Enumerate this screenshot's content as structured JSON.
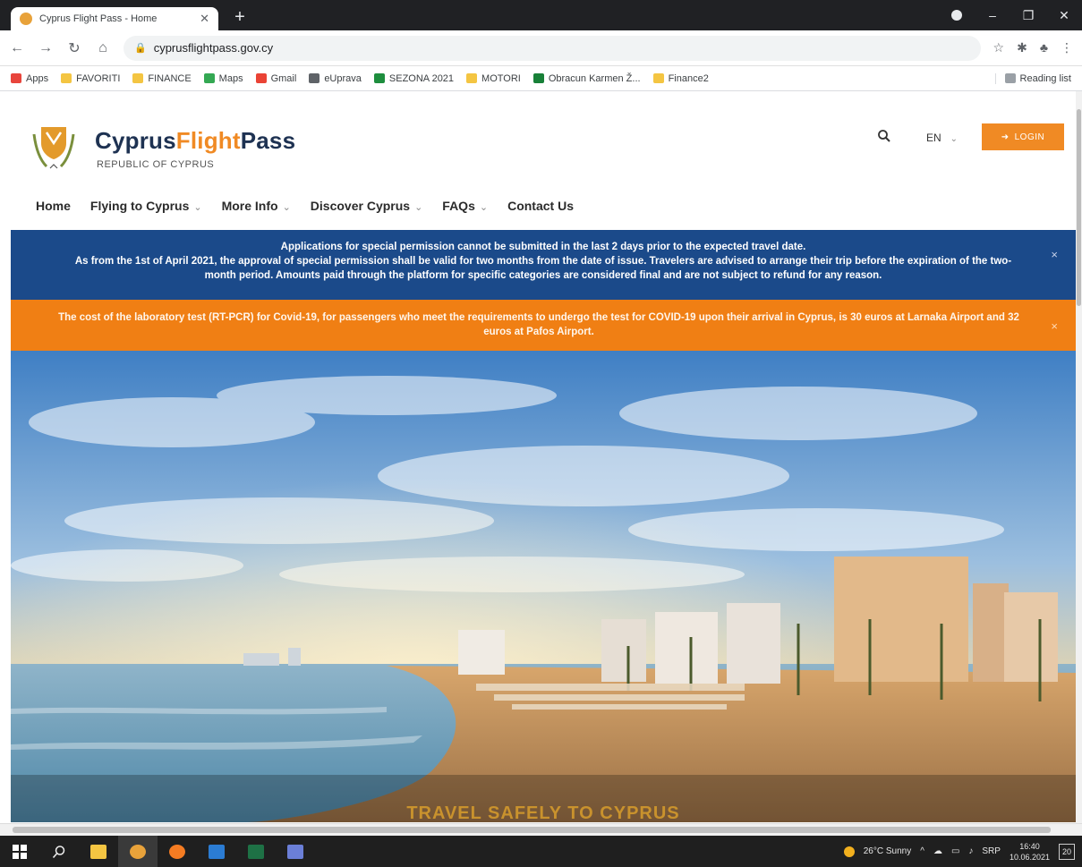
{
  "browser": {
    "tab_title": "Cyprus Flight Pass - Home",
    "url": "cyprusflightpass.gov.cy",
    "bookmarks": [
      {
        "label": "Apps",
        "color": "#e8453c"
      },
      {
        "label": "FAVORITI",
        "color": "#f4c542"
      },
      {
        "label": "FINANCE",
        "color": "#f4c542"
      },
      {
        "label": "Maps",
        "color": "#34a853"
      },
      {
        "label": "Gmail",
        "color": "#ea4335"
      },
      {
        "label": "eUprava",
        "color": "#5f6368"
      },
      {
        "label": "SEZONA 2021",
        "color": "#1e8e3e"
      },
      {
        "label": "MOTORI",
        "color": "#f4c542"
      },
      {
        "label": "Obracun Karmen Ž...",
        "color": "#188038"
      },
      {
        "label": "Finance2",
        "color": "#f4c542"
      }
    ],
    "reading_list": "Reading list"
  },
  "site": {
    "brand_part1": "Cyprus",
    "brand_part2": "Flight",
    "brand_part3": "Pass",
    "brand_sub": "REPUBLIC OF CYPRUS",
    "lang": "EN",
    "login": "LOGIN",
    "nav": [
      {
        "label": "Home",
        "dropdown": false
      },
      {
        "label": "Flying to Cyprus",
        "dropdown": true
      },
      {
        "label": "More Info",
        "dropdown": true
      },
      {
        "label": "Discover Cyprus",
        "dropdown": true
      },
      {
        "label": "FAQs",
        "dropdown": true
      },
      {
        "label": "Contact Us",
        "dropdown": false
      }
    ]
  },
  "notices": {
    "blue_line1": "Applications for special permission cannot be submitted in the last 2 days prior to the expected travel date.",
    "blue_line2_pre": "As from the 1st of April 2021, the approval of special permission shall be valid for two months from the date of issue. Travelers are advised to arrange their trip before the expiration of the ",
    "blue_line2_strong": "two-month",
    "blue_line2_post": " period. Amounts paid through the platform for specific categories are considered final and are not subject to refund for any reason.",
    "orange": "The cost of the laboratory test (RT-PCR) for Covid-19, for passengers who meet the requirements to undergo the test for COVID-19 upon their arrival in Cyprus, is 30 euros at Larnaka Airport and 32 euros at Pafos Airport.",
    "close": "×"
  },
  "hero": {
    "caption": "TRAVEL SAFELY TO CYPRUS"
  },
  "taskbar": {
    "weather": "26°C Sunny",
    "lang": "SRP",
    "time": "16:40",
    "date": "10.06.2021",
    "notifications": "20"
  }
}
